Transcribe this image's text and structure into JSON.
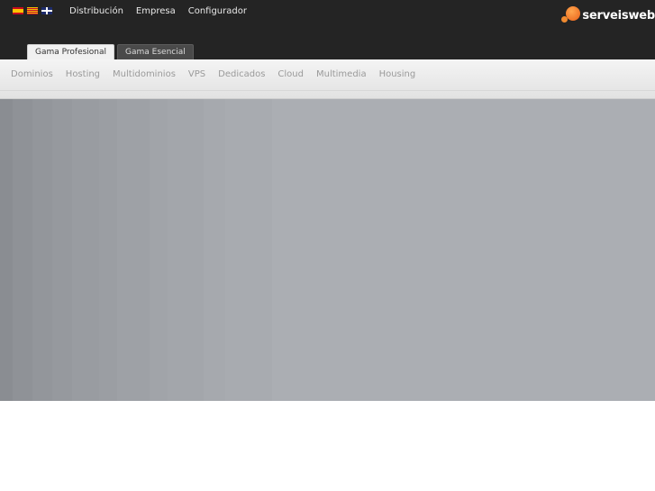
{
  "header": {
    "flags": [
      "flag-es-icon",
      "flag-ca-icon",
      "flag-en-icon"
    ],
    "nav": [
      {
        "label": "Distribución"
      },
      {
        "label": "Empresa"
      },
      {
        "label": "Configurador"
      }
    ],
    "logo_text": "serveisweb"
  },
  "tabs": [
    {
      "label": "Gama Profesional",
      "active": true
    },
    {
      "label": "Gama Esencial",
      "active": false
    }
  ],
  "subnav": {
    "items": [
      "Dominios",
      "Hosting",
      "Multidominios",
      "VPS",
      "Dedicados",
      "Cloud",
      "Multimedia",
      "Housing"
    ]
  },
  "colors": {
    "topbar": "#242424",
    "logo_accent": "#f08a30",
    "banner": "#abaeb3"
  }
}
